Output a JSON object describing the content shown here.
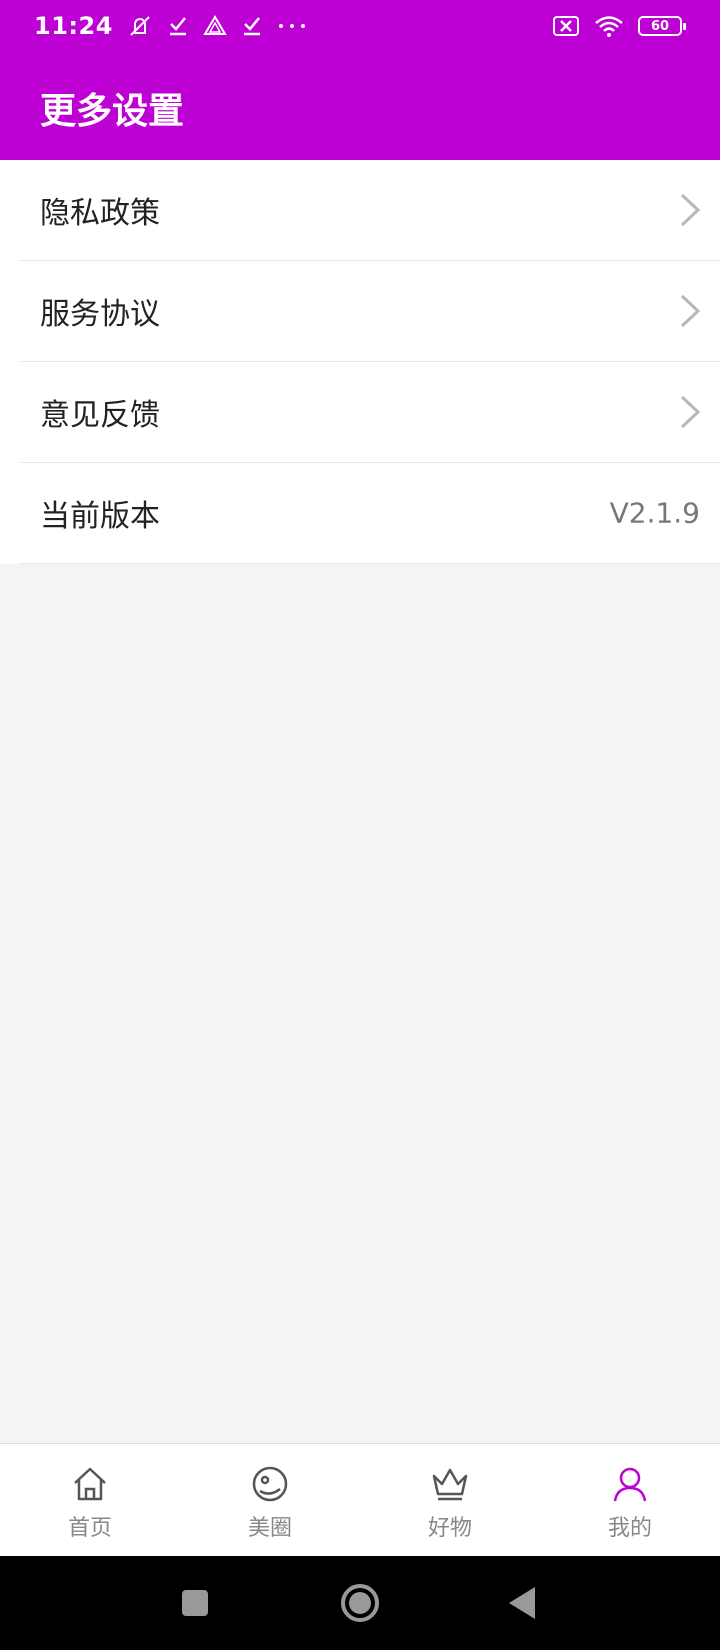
{
  "status_bar": {
    "time": "11:24",
    "battery": "60",
    "icons": [
      "mute-icon",
      "check-icon",
      "drive-icon",
      "check-icon",
      "more-icon",
      "sim-off-icon",
      "wifi-icon",
      "battery-icon"
    ]
  },
  "header": {
    "title": "更多设置"
  },
  "settings": {
    "items": [
      {
        "label": "隐私政策",
        "icon": "chevron-right-icon"
      },
      {
        "label": "服务协议",
        "icon": "chevron-right-icon"
      },
      {
        "label": "意见反馈",
        "icon": "chevron-right-icon"
      },
      {
        "label": "当前版本",
        "value": "V2.1.9"
      }
    ]
  },
  "tab_bar": {
    "tabs": [
      {
        "label": "首页",
        "icon": "home-icon"
      },
      {
        "label": "美圈",
        "icon": "circle-face-icon"
      },
      {
        "label": "好物",
        "icon": "crown-icon"
      },
      {
        "label": "我的",
        "icon": "user-icon",
        "active": true
      }
    ]
  },
  "colors": {
    "brand": "#bd00d4",
    "active_icon": "#bd00d4",
    "inactive_icon": "#555555"
  },
  "nav_bar": {
    "icons": [
      "recents-square-icon",
      "home-circle-icon",
      "back-triangle-icon"
    ]
  }
}
